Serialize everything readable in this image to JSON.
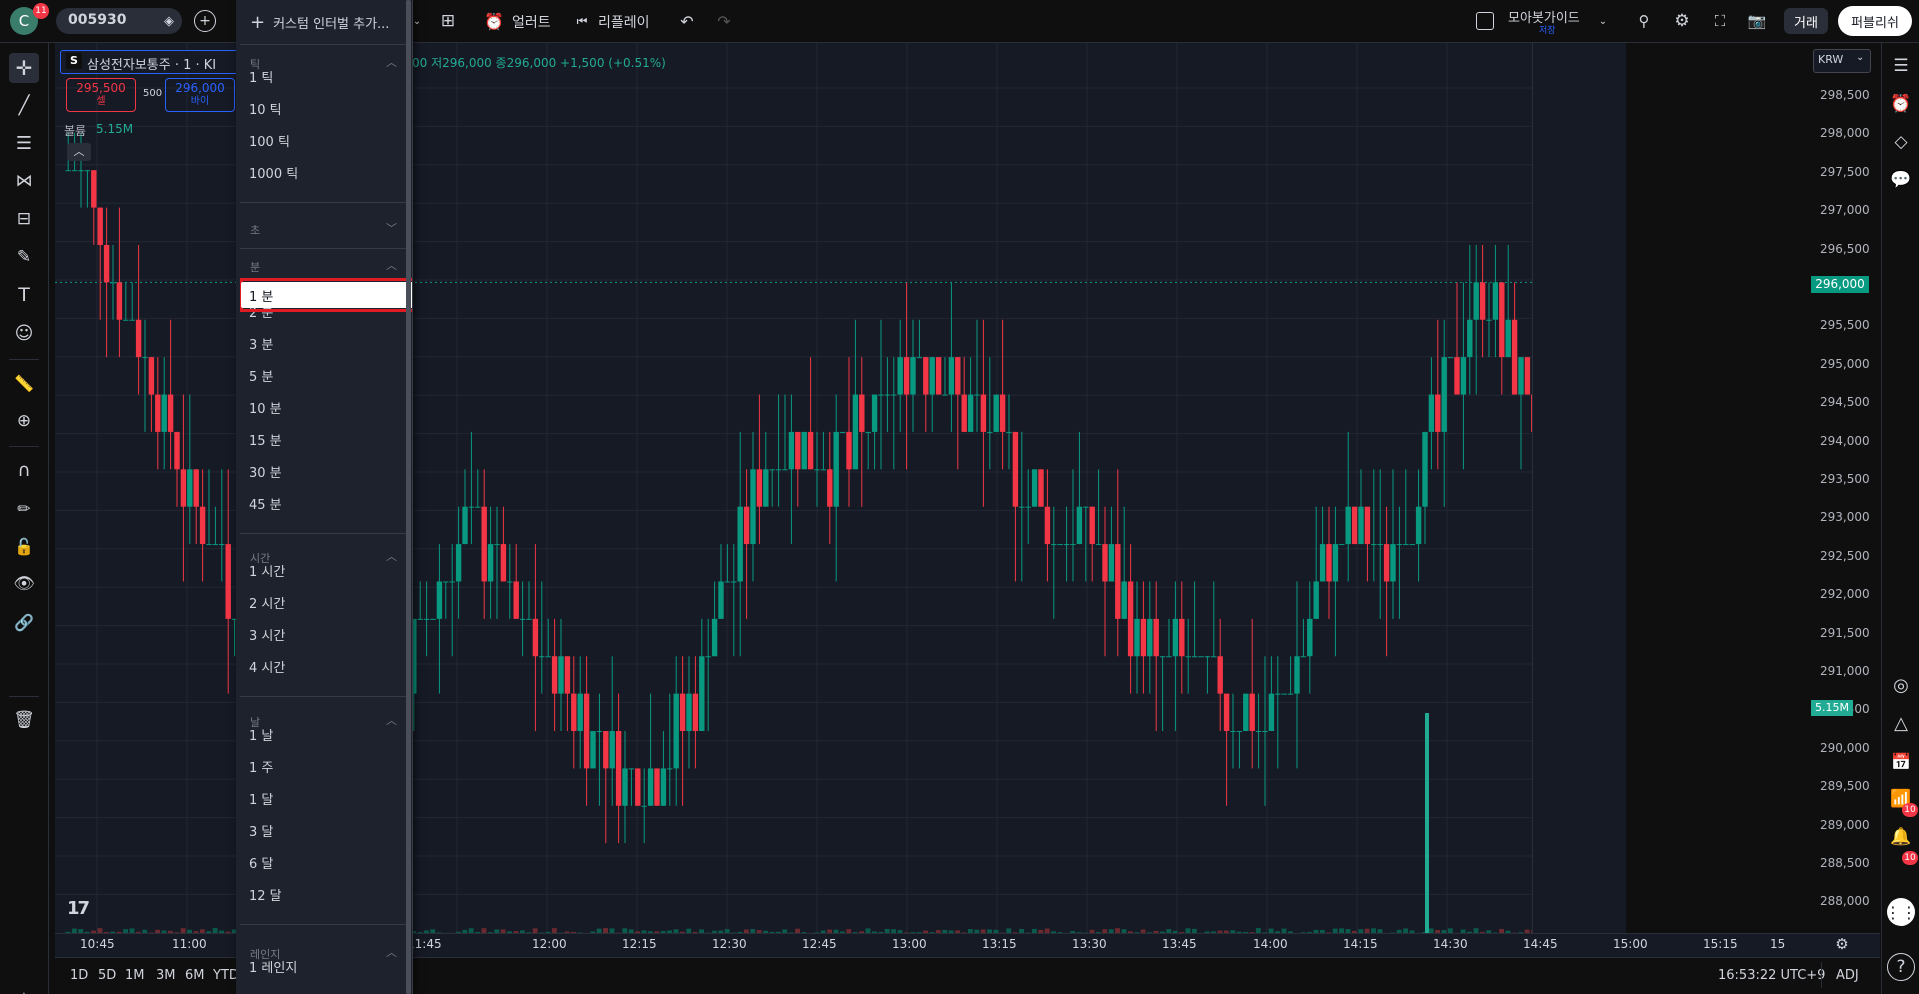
{
  "topbar": {
    "avatar_letter": "C",
    "avatar_badge": "11",
    "symbol": "005930",
    "custom_interval_add": "커스텀 인터벌 추가...",
    "alert_label": "얼러트",
    "replay_label": "리플레이",
    "layout_name": "모아봇가이드",
    "layout_status": "저장",
    "trade_button": "거래",
    "publish_button": "퍼블리쉬"
  },
  "interval_menu": {
    "sections": [
      {
        "title": "틱",
        "expanded": true,
        "items": [
          "1 틱",
          "10 틱",
          "100 틱",
          "1000 틱"
        ]
      },
      {
        "title": "초",
        "expanded": false,
        "items": []
      },
      {
        "title": "분",
        "expanded": true,
        "items": [
          "1 분",
          "2 분",
          "3 분",
          "5 분",
          "10 분",
          "15 분",
          "30 분",
          "45 분"
        ]
      },
      {
        "title": "시간",
        "expanded": true,
        "items": [
          "1 시간",
          "2 시간",
          "3 시간",
          "4 시간"
        ]
      },
      {
        "title": "날",
        "expanded": true,
        "items": [
          "1 날",
          "1 주",
          "1 달",
          "3 달",
          "6 달",
          "12 달"
        ]
      },
      {
        "title": "레인지",
        "expanded": true,
        "items": [
          "1 레인지"
        ]
      }
    ],
    "selected": "1 분"
  },
  "legend": {
    "symbol_letter": "S",
    "symbol_title": "삼성전자보통주 · 1 · KI",
    "ohlc_tail": "00 저296,000 종296,000 +1,500 (+0.51%)",
    "sell_price": "295,500",
    "sell_label": "셀",
    "spread": "500",
    "buy_price": "296,000",
    "buy_label": "바이",
    "volume_label": "볼륨",
    "volume_value": "5.15M"
  },
  "price_axis": {
    "currency": "KRW",
    "labels": [
      "298,500",
      "298,000",
      "297,500",
      "297,000",
      "296,500",
      "296,000",
      "295,500",
      "295,000",
      "294,500",
      "294,000",
      "293,500",
      "293,000",
      "292,500",
      "292,000",
      "291,500",
      "291,000",
      "290,500",
      "290,000",
      "289,500",
      "289,000",
      "288,500",
      "288,000"
    ],
    "current_price": "296,000",
    "volume_badge": "5.15M"
  },
  "time_axis": {
    "labels": [
      "10:45",
      "11:00",
      "11:45",
      "12:00",
      "12:15",
      "12:30",
      "12:45",
      "13:00",
      "13:15",
      "13:30",
      "13:45",
      "14:00",
      "14:15",
      "14:30",
      "14:45",
      "15:00",
      "15:15",
      "15"
    ]
  },
  "bottom_bar": {
    "ranges": [
      "1D",
      "5D",
      "1M",
      "3M",
      "6M",
      "YTD"
    ],
    "clock": "16:53:22 UTC+9",
    "adj": "ADJ"
  },
  "right_toolbar": {
    "feed_badge": "10",
    "alerts_badge": "10"
  },
  "colors": {
    "up": "#089981",
    "down": "#f23645",
    "background": "#161a25",
    "selection_outline": "#e11b22"
  },
  "chart_data": {
    "type": "candlestick",
    "interval": "1 분",
    "ylim": [
      287700,
      298800
    ],
    "time_labels": [
      "10:45",
      "11:00",
      "11:45",
      "12:00",
      "12:15",
      "12:30",
      "12:45",
      "13:00",
      "13:15",
      "13:30",
      "13:45",
      "14:00",
      "14:15",
      "14:30",
      "14:45",
      "15:00",
      "15:15"
    ],
    "close_path": [
      297500,
      297000,
      296000,
      295000,
      294000,
      293000,
      292500,
      291500,
      291000,
      290500,
      290000,
      289000,
      289500,
      290500,
      291000,
      292000,
      292800,
      292500,
      291500,
      291000,
      290500,
      290000,
      289600,
      289300,
      289700,
      290200,
      291500,
      292500,
      293500,
      294000,
      293800,
      293500,
      294000,
      294500,
      295000,
      295000,
      294500,
      294000,
      293500,
      293000,
      292500,
      292800,
      292000,
      291300,
      290800,
      291000,
      290600,
      290300,
      290000,
      290600,
      291500,
      292500,
      292800,
      292300,
      293000,
      294000,
      295000,
      296000,
      295000,
      294300
    ],
    "last_close": 296000,
    "volume_last": "5.15M"
  }
}
